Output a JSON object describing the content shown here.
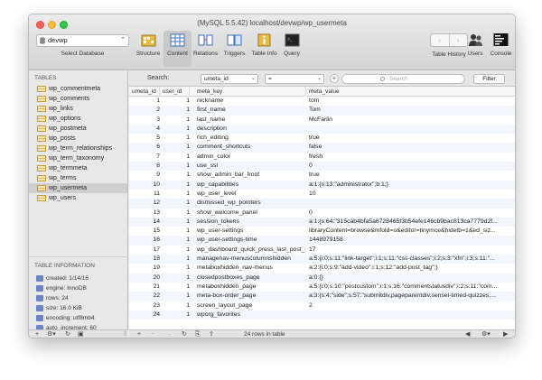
{
  "window": {
    "title": "(MySQL 5.5.42) localhost/devwp/wp_usermeta"
  },
  "toolbar": {
    "database": "devwp",
    "database_label": "Select Database",
    "buttons": [
      {
        "label": "Structure",
        "icon": "structure-icon"
      },
      {
        "label": "Content",
        "icon": "content-icon"
      },
      {
        "label": "Relations",
        "icon": "relations-icon"
      },
      {
        "label": "Triggers",
        "icon": "triggers-icon"
      },
      {
        "label": "Table Info",
        "icon": "table-info-icon"
      },
      {
        "label": "Query",
        "icon": "query-icon"
      }
    ],
    "right_buttons": [
      {
        "label": "Table History",
        "icon": "history-nav-icon"
      },
      {
        "label": "Users",
        "icon": "users-icon"
      },
      {
        "label": "Console",
        "icon": "console-icon"
      }
    ],
    "active": "Content"
  },
  "sidebar": {
    "tables_header": "TABLES",
    "tables": [
      "wp_commentmeta",
      "wp_comments",
      "wp_links",
      "wp_options",
      "wp_postmeta",
      "wp_posts",
      "wp_term_relationships",
      "wp_term_taxonomy",
      "wp_termmeta",
      "wp_terms",
      "wp_usermeta",
      "wp_users"
    ],
    "selected_table": "wp_usermeta",
    "info_header": "TABLE INFORMATION",
    "info": [
      "created: 1/14/16",
      "engine: InnoDB",
      "rows: 24",
      "size: 16.0 KiB",
      "encoding: utf8mb4",
      "auto_increment: 60"
    ]
  },
  "filter": {
    "search_label": "Search:",
    "field": "umeta_id",
    "operator": "=",
    "placeholder": "Search",
    "button": "Filter"
  },
  "grid": {
    "columns": [
      "umeta_id",
      "user_id",
      "meta_key",
      "meta_value"
    ],
    "rows": [
      [
        "1",
        "1",
        "nickname",
        "tom"
      ],
      [
        "2",
        "1",
        "first_name",
        "Tom"
      ],
      [
        "3",
        "1",
        "last_name",
        "McFarlin"
      ],
      [
        "4",
        "1",
        "description",
        ""
      ],
      [
        "5",
        "1",
        "rich_editing",
        "true"
      ],
      [
        "6",
        "1",
        "comment_shortcuts",
        "false"
      ],
      [
        "7",
        "1",
        "admin_color",
        "fresh"
      ],
      [
        "8",
        "1",
        "use_ssl",
        "0"
      ],
      [
        "9",
        "1",
        "show_admin_bar_front",
        "true"
      ],
      [
        "10",
        "1",
        "wp_capabilities",
        "a:1:{s:13:\"administrator\";b:1;}"
      ],
      [
        "11",
        "1",
        "wp_user_level",
        "10"
      ],
      [
        "12",
        "1",
        "dismissed_wp_pointers",
        ""
      ],
      [
        "13",
        "1",
        "show_welcome_panel",
        "0"
      ],
      [
        "14",
        "1",
        "session_tokens",
        "a:1:{s:64:\"315cab4bfa5a6728465f3b54efe146cb9bac813ca7779d2f..."
      ],
      [
        "15",
        "1",
        "wp_user-settings",
        "libraryContent=browse&mfold=o&editor=tinymce&hidetb=1&ed_siz..."
      ],
      [
        "16",
        "1",
        "wp_user-settings-time",
        "1448979158"
      ],
      [
        "17",
        "1",
        "wp_dashboard_quick_press_last_post_id",
        "17"
      ],
      [
        "18",
        "1",
        "managenav-menuscolumnshidden",
        "a:5:{i:0;s:11:\"link-target\";i:1;s:11:\"css-classes\";i:2;s:3:\"xfn\";i:3;s:11:\"..."
      ],
      [
        "19",
        "1",
        "metaboxhidden_nav-menus",
        "a:2:{i:0;s:9:\"add-video\";i:1;s:12:\"add-post_tag\";}"
      ],
      [
        "20",
        "1",
        "closedpostboxes_page",
        "a:0:{}"
      ],
      [
        "21",
        "1",
        "metaboxhidden_page",
        "a:5:{i:0;s:10:\"postcustom\";i:1;s:16:\"commentstatusdiv\";i:2;s:11:\"com..."
      ],
      [
        "22",
        "1",
        "meta-box-order_page",
        "a:3:{s:4:\"side\";s:57:\"submitdiv,pageparentdiv,sensei-timed-quizzes,..."
      ],
      [
        "23",
        "1",
        "screen_layout_page",
        "2"
      ],
      [
        "24",
        "1",
        "wporg_favorites",
        ""
      ]
    ]
  },
  "status": {
    "row_count": "24 rows in table"
  },
  "colors": {
    "accent": "#3b82f6",
    "selection": "#cfcfcf"
  }
}
